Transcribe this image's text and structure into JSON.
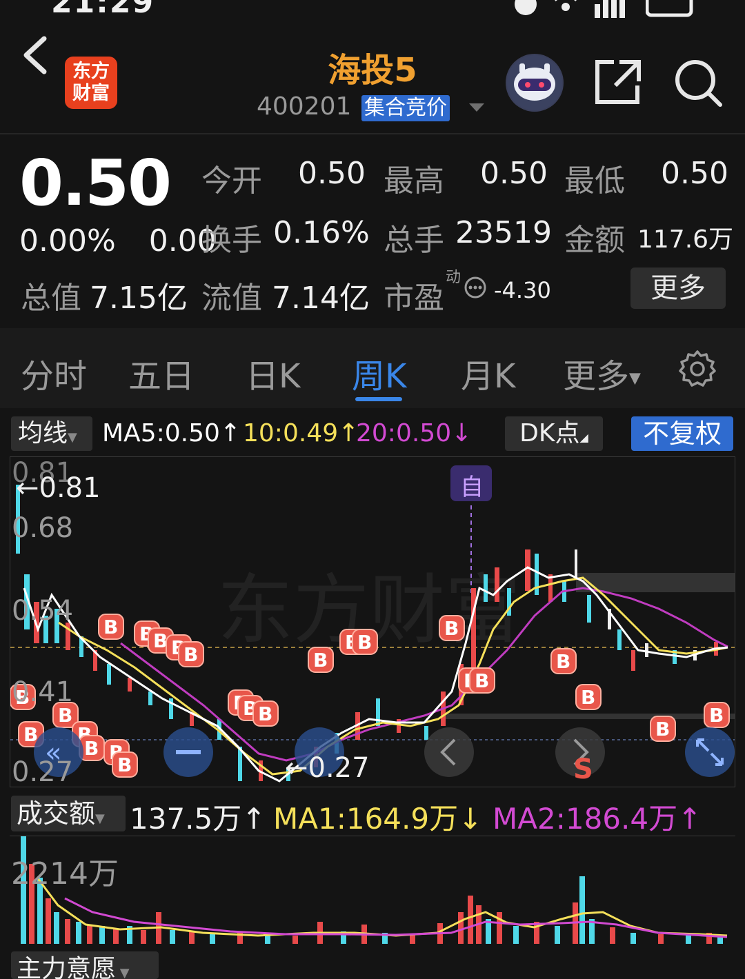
{
  "status": {
    "time": "21:29"
  },
  "header": {
    "title": "海投5",
    "code": "400201",
    "tag": "集合竞价",
    "logo_line1": "东方",
    "logo_line2": "财富"
  },
  "quote": {
    "price": "0.50",
    "change_pct": "0.00%",
    "change_amt": "0.00",
    "open_label": "今开",
    "open": "0.50",
    "high_label": "最高",
    "high": "0.50",
    "low_label": "最低",
    "low": "0.50",
    "turnover_label": "换手",
    "turnover": "0.16%",
    "volume_label": "总手",
    "volume": "23519",
    "amount_label": "金额",
    "amount": "117.6万",
    "mktcap_label": "总值",
    "mktcap": "7.15亿",
    "float_label": "流值",
    "float": "7.14亿",
    "pe_label": "市盈",
    "pe_sup": "动",
    "pe": "-4.30",
    "more": "更多"
  },
  "tabs": [
    {
      "label": "分时"
    },
    {
      "label": "五日"
    },
    {
      "label": "日K"
    },
    {
      "label": "周K",
      "active": true
    },
    {
      "label": "月K"
    },
    {
      "label": "更多"
    }
  ],
  "ma": {
    "selector": "均线",
    "ma5": "MA5:0.50↑",
    "ma10": "10:0.49↑",
    "ma20": "20:0.50↓",
    "dk": "DK点",
    "adjust": "不复权",
    "colors": {
      "ma5": "#ffffff",
      "ma10": "#f5e05a",
      "ma20": "#d24ad2"
    }
  },
  "chart": {
    "y_labels": [
      "0.81",
      "0.68",
      "0.54",
      "0.41",
      "0.27"
    ],
    "max_marker": "←0.81",
    "min_marker": "←0.27",
    "self_marker": "自",
    "s_marker": "S",
    "watermark": "东方财富"
  },
  "volume": {
    "selector": "成交额",
    "current": "137.5万↑",
    "ma1": "MA1:164.9万↓",
    "ma2": "MA2:186.4万↑",
    "max_label": "2214万"
  },
  "bottom": {
    "selector": "主力意愿"
  }
}
